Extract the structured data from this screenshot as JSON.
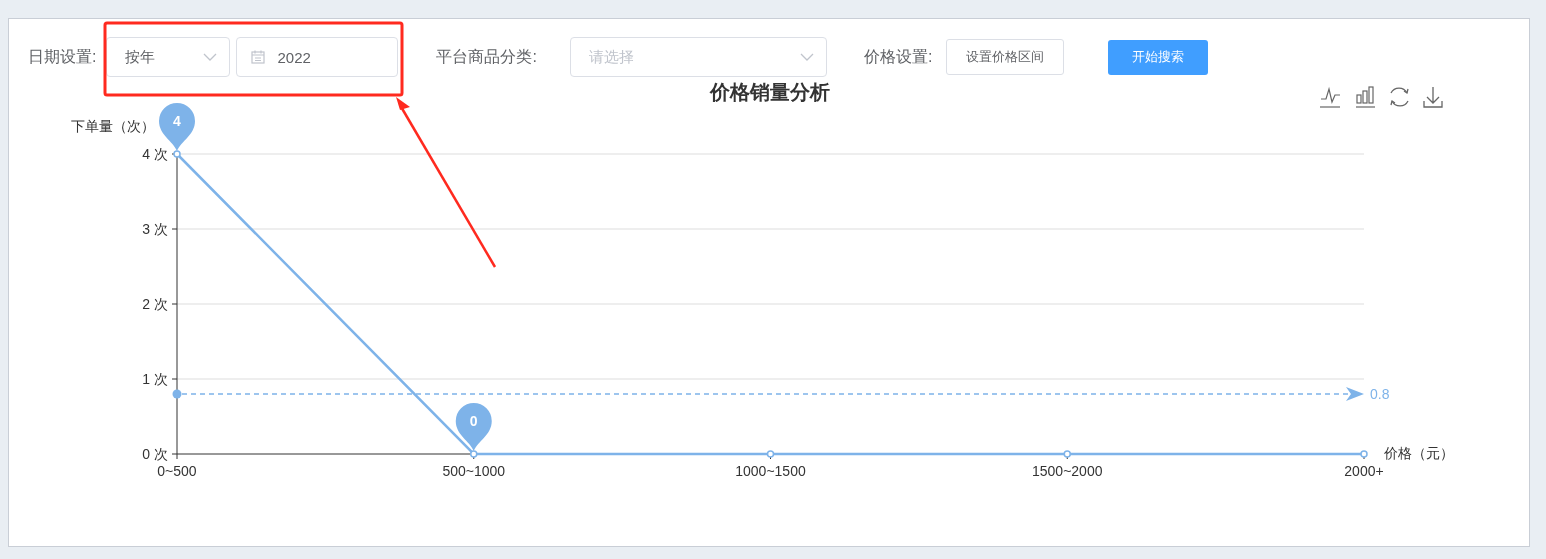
{
  "filters": [
    {
      "kind": "select",
      "label": "日期设置:",
      "value": "按年"
    },
    {
      "kind": "date",
      "value": "2022"
    },
    {
      "kind": "select",
      "label": "平台商品分类:",
      "placeholder": "请选择",
      "wide": true
    },
    {
      "kind": "button",
      "label": "价格设置:",
      "text": "设置价格区间"
    },
    {
      "kind": "primary",
      "text": "开始搜索"
    }
  ],
  "chart": {
    "chart_data": {
      "type": "line",
      "title": "价格销量分析",
      "xlabel": "价格（元）",
      "ylabel": "下单量（次）",
      "categories": [
        "0~500",
        "500~1000",
        "1000~1500",
        "1500~2000",
        "2000+"
      ],
      "series": [
        {
          "color": "#7eb3e9",
          "marker": "circle",
          "values": [
            4,
            0,
            0,
            0,
            0
          ]
        }
      ],
      "grid": true,
      "ylim": [
        0,
        4
      ],
      "yticks": [
        {
          "value": 0,
          "label": "0 次"
        },
        {
          "value": 1,
          "label": "1 次"
        },
        {
          "value": 2,
          "label": "2 次"
        },
        {
          "value": 3,
          "label": "3 次"
        },
        {
          "value": 4,
          "label": "4 次"
        }
      ],
      "annotations": [
        {
          "text": "4",
          "x": "0~500",
          "y": 4
        },
        {
          "text": "0",
          "x": "500~1000",
          "y": 0
        }
      ],
      "ref_lines": [
        {
          "axis": "y",
          "value": 0.8,
          "label": "0.8",
          "color": "#7eb3e9"
        }
      ]
    }
  },
  "annotation": {
    "kind": "red-box-arrow",
    "color": "#ff2a1f"
  }
}
